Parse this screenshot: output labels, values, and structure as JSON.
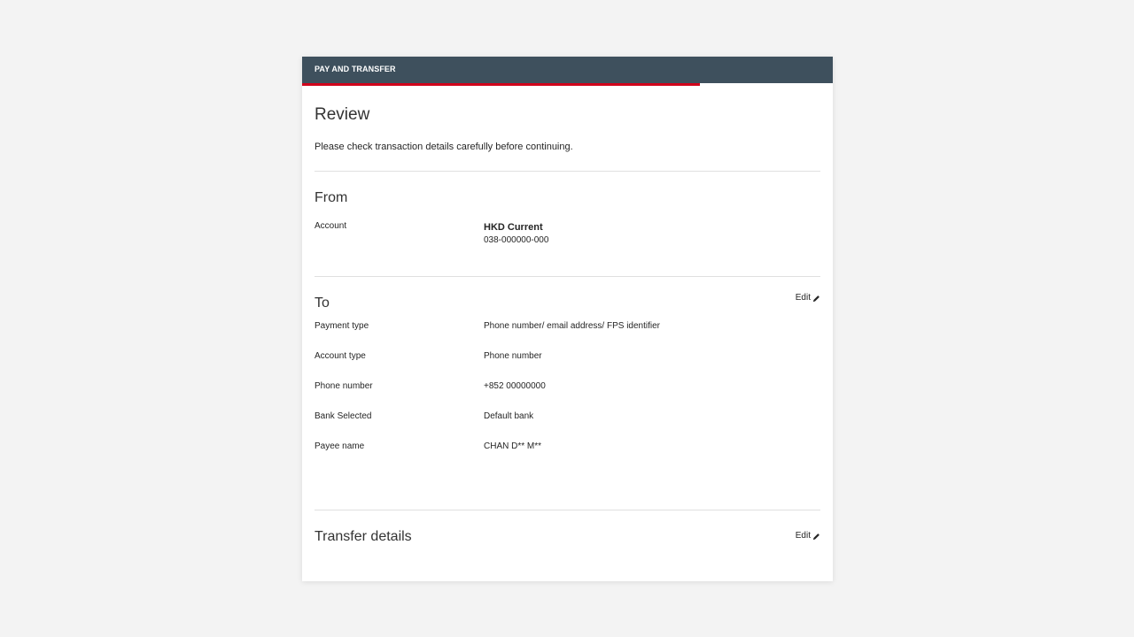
{
  "header": {
    "title": "PAY AND TRANSFER"
  },
  "progress": {
    "fraction": 0.75,
    "color": "#d0021b"
  },
  "page": {
    "title": "Review",
    "intro": "Please check transaction details carefully before continuing."
  },
  "from": {
    "title": "From",
    "account_label": "Account",
    "account_name": "HKD Current",
    "account_number": "038-000000-000"
  },
  "to": {
    "title": "To",
    "edit_label": "Edit",
    "rows": [
      {
        "label": "Payment type",
        "value": "Phone number/ email address/ FPS identifier"
      },
      {
        "label": "Account type",
        "value": "Phone number"
      },
      {
        "label": "Phone number",
        "value": "+852 00000000"
      },
      {
        "label": "Bank Selected",
        "value": "Default bank"
      },
      {
        "label": "Payee name",
        "value": "CHAN D** M**"
      }
    ]
  },
  "transfer": {
    "title": "Transfer details",
    "edit_label": "Edit"
  },
  "colors": {
    "header_bg": "#3e505d",
    "accent": "#d0021b"
  },
  "icons": {
    "edit": "pencil-icon"
  }
}
